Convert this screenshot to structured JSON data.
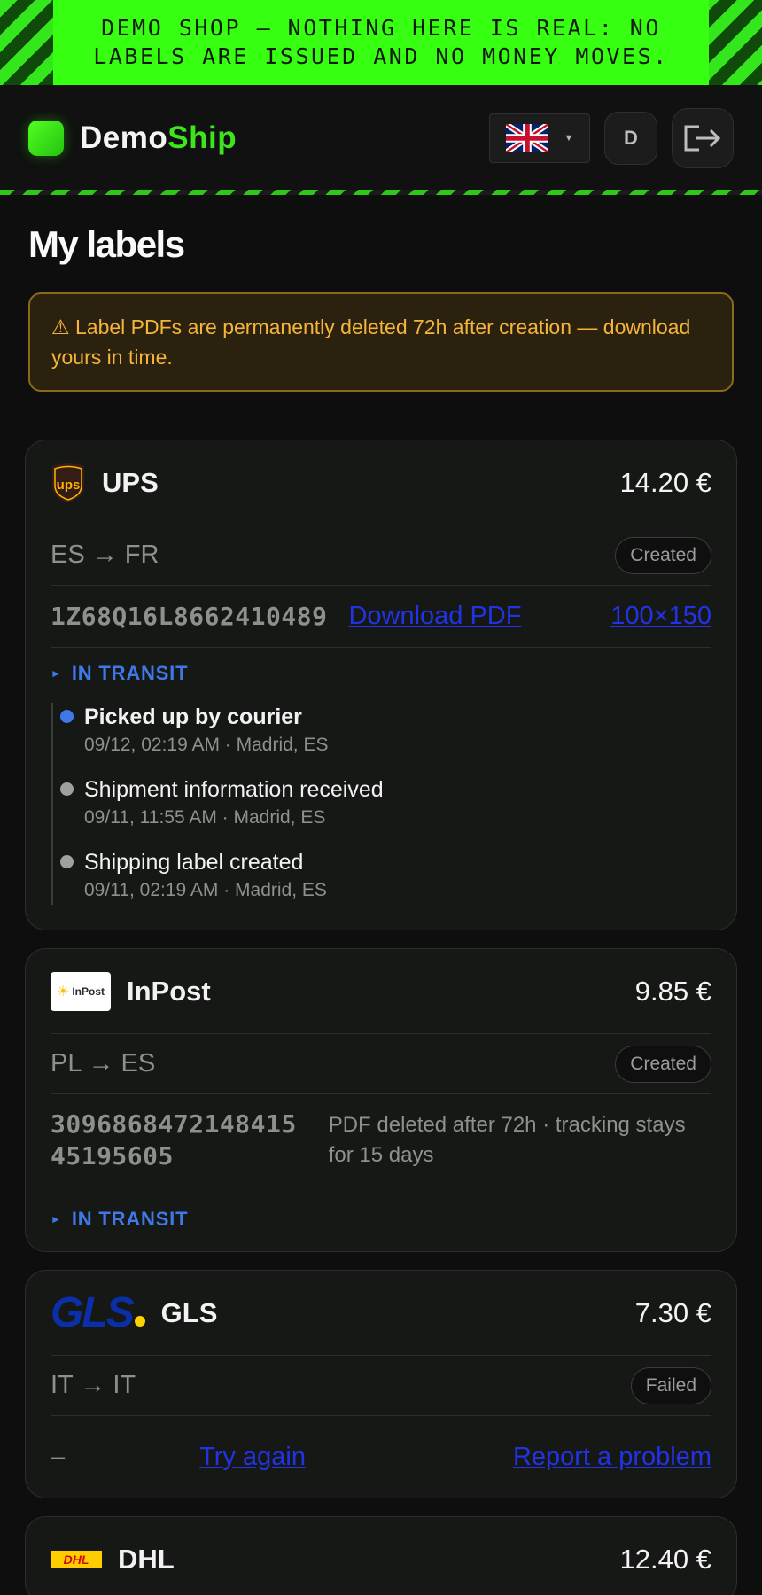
{
  "banner": {
    "text": "DEMO SHOP — NOTHING HERE IS REAL: NO LABELS ARE ISSUED AND NO MONEY MOVES."
  },
  "header": {
    "brand_demo": "Demo",
    "brand_ship": "Ship",
    "language_flag": "uk-flag-icon",
    "avatar_initial": "D",
    "logout_icon": "logout-icon"
  },
  "page": {
    "title": "My labels",
    "notice": {
      "icon": "⚠",
      "text": "Label PDFs are permanently deleted 72h after creation — download yours in time."
    }
  },
  "labels": [
    {
      "carrier": "UPS",
      "logo": "ups-logo-icon",
      "price": "14.20 €",
      "route": "ES → FR",
      "badge": "Created",
      "tracking": "1Z68Q16L8662410489",
      "download_label": "Download PDF",
      "format_label": "100×150",
      "status": "IN TRANSIT",
      "events": [
        {
          "title": "Picked up by courier",
          "meta": "09/12, 02:19 AM · Madrid, ES"
        },
        {
          "title": "Shipment information received",
          "meta": "09/11, 11:55 AM · Madrid, ES"
        },
        {
          "title": "Shipping label created",
          "meta": "09/11, 02:19 AM · Madrid, ES"
        }
      ]
    },
    {
      "carrier": "InPost",
      "logo": "inpost-logo-icon",
      "logo_text": "InPost",
      "price": "9.85 €",
      "route": "PL → ES",
      "badge": "Created",
      "tracking_line1": "3096868472148415",
      "tracking_line2": "45195605",
      "pdf_note": "PDF deleted after 72h · tracking stays for 15 days",
      "status": "IN TRANSIT"
    },
    {
      "carrier": "GLS",
      "logo": "gls-logo-icon",
      "logo_text": "GLS",
      "price": "7.30 €",
      "route": "IT → IT",
      "badge": "Failed",
      "tracking": "–",
      "retry_label": "Try again",
      "report_label": "Report a problem"
    },
    {
      "carrier": "DHL",
      "logo": "dhl-logo-icon",
      "logo_text": "DHL",
      "price": "12.40 €"
    }
  ],
  "colors": {
    "accent_green": "#37ff12",
    "link_blue": "#2233e6",
    "status_blue": "#3f79e8",
    "warning_amber": "#f5b43a"
  }
}
